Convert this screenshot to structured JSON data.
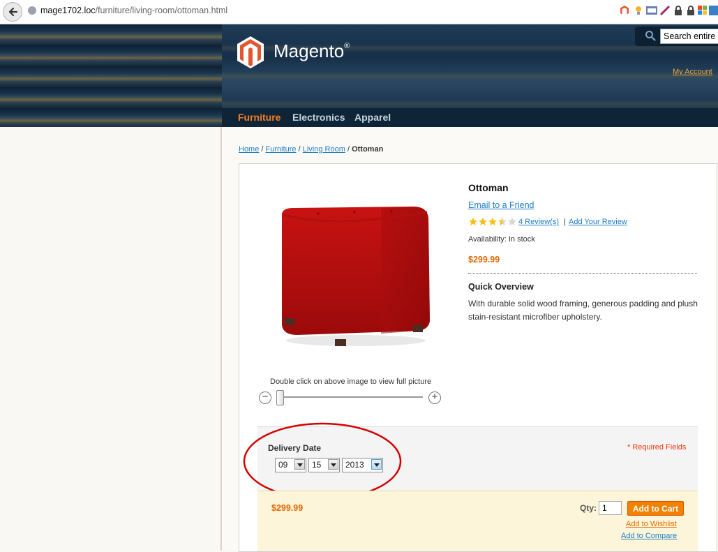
{
  "browser": {
    "url_host": "mage1702.loc",
    "url_path": "/furniture/living-room/ottoman.html"
  },
  "header": {
    "logo_text": "Magento",
    "logo_reg": "®",
    "search_placeholder": "Search entire store here...",
    "my_account": "My Account"
  },
  "nav": {
    "items": [
      "Furniture",
      "Electronics",
      "Apparel"
    ],
    "active": "Furniture"
  },
  "breadcrumb": {
    "home": "Home",
    "sep": "/",
    "furniture": "Furniture",
    "living_room": "Living Room",
    "current": "Ottoman"
  },
  "product": {
    "name": "Ottoman",
    "email_friend": "Email to a Friend",
    "rating_stars": 3.5,
    "rating_max": 5,
    "reviews_link": "4 Review(s)",
    "review_sep": "|",
    "add_review": "Add Your Review",
    "availability": "Availability: In stock",
    "price": "$299.99",
    "quick_overview_title": "Quick Overview",
    "quick_overview_text": "With durable solid wood framing, generous padding and plush stain-resistant microfiber upholstery."
  },
  "image_zoom": {
    "note": "Double click on above image to view full picture",
    "zoom_out_symbol": "−",
    "zoom_in_symbol": "+",
    "zoom_level": 0
  },
  "options": {
    "delivery_label": "Delivery Date",
    "required_note": "* Required Fields",
    "month": "09",
    "day": "15",
    "year": "2013"
  },
  "cart": {
    "price": "$299.99",
    "qty_label": "Qty:",
    "qty_value": "1",
    "add_to_cart": "Add to Cart",
    "add_to_wishlist": "Add to Wishlist",
    "add_to_compare": "Add to Compare"
  },
  "colors": {
    "accent_orange": "#f18200",
    "price_orange": "#e26703",
    "link_blue": "#1e7ec8",
    "highlight_circle": "#d40000"
  }
}
